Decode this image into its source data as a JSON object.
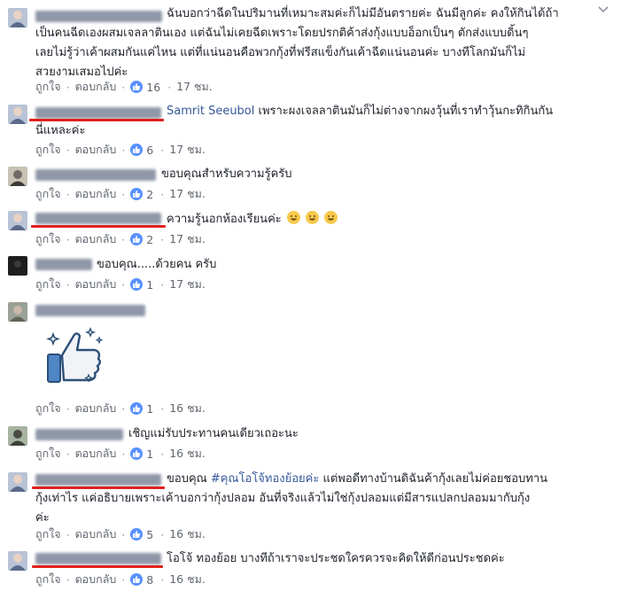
{
  "actions": {
    "like": "ถูกใจ",
    "reply": "ตอบกลับ",
    "separator": "·"
  },
  "comments": [
    {
      "name": "Kasem Pom Pimsin",
      "lines": [
        "ฉันบอกว่าฉีดในปริมานที่เหมาะสมค่ะก็ไม่มีอันตรายค่ะ ฉันมีลูกค่ะ คงให้กินได้ถ้า",
        "เป็นคนฉีดเองผสมเจลลาตินเอง แต่ฉันไม่เคยฉีดเพราะโดยปรกติค้าส่งกุ้งแบบอ็อกเป็นๆ ตักส่งแบบดิ้นๆ",
        "เลยไม่รู้ว่าเค้าผสมกันแค่ไหน แต่ที่แน่นอนคือพวกกุ้งที่ฟรีสแข็งกันเค้าฉีดแน่นอนค่ะ บางทีโลกมันก็ไม่",
        "สวยงามเสมอไปค่ะ"
      ],
      "likes": "16",
      "time": "17 ชม."
    },
    {
      "name": "Kasem Pom Pimsin",
      "mention": "Samrit Seeubol",
      "lines": [
        "เพราะผงเจลลาตินมันก็ไม่ต่างจากผงวุ้นที่เราทำวุ้นกะทิกินกัน",
        "นี่แหละค่ะ"
      ],
      "likes": "6",
      "time": "17 ชม."
    },
    {
      "name": "Autumn Na Na Ruki",
      "lines": [
        "ขอบคุณสำหรับความรู้ครับ"
      ],
      "likes": "2",
      "time": "17 ชม."
    },
    {
      "name": "Kasem Pom Pimsin",
      "lines": [
        "ความรู้นอกห้องเรียนค่ะ"
      ],
      "emoji_count": 3,
      "likes": "2",
      "time": "17 ชม."
    },
    {
      "name": "Fon Mani",
      "lines": [
        "ขอบคุณ.....ด้วยคน ครับ"
      ],
      "likes": "1",
      "time": "17 ชม."
    },
    {
      "name": "Trimal somsakdee",
      "sticker": "thumbs-up-sparkle",
      "likes": "1",
      "time": "16 ชม."
    },
    {
      "name": "Toffi nasakul",
      "lines": [
        "เชิญแม่รับประทานคนเดียวเถอะนะ"
      ],
      "likes": "1",
      "time": "16 ชม."
    },
    {
      "name": "Kasem Pom Pimsin",
      "lines_prefix": "ขอบคุณ",
      "hashtag": "#คุณโอโจ้ทองย้อยค่ะ",
      "lines": [
        "แต่พอดีทางบ้านดิฉันค้ากุ้งเลยไม่ค่อยชอบทาน",
        "กุ้งเท่าไร แค่อธิบายเพราะเค้าบอกว่ากุ้งปลอม อันที่จริงแล้วไม่ใช่กุ้งปลอมแต่มีสารแปลกปลอมมากับกุ้ง",
        "ค่ะ"
      ],
      "likes": "5",
      "time": "16 ชม."
    },
    {
      "name": "Kasem Pom Pimsin",
      "lines": [
        "โอโจ้ ทองย้อย บางทีถ้าเราจะประชดใครควรจะคิดให้ดีก่อนประชดค่ะ"
      ],
      "likes": "8",
      "time": "16 ชม."
    }
  ],
  "colors": {
    "link": "#365899",
    "muted": "#616770",
    "badge": "#5890ff",
    "highlight": "#e0211c"
  }
}
